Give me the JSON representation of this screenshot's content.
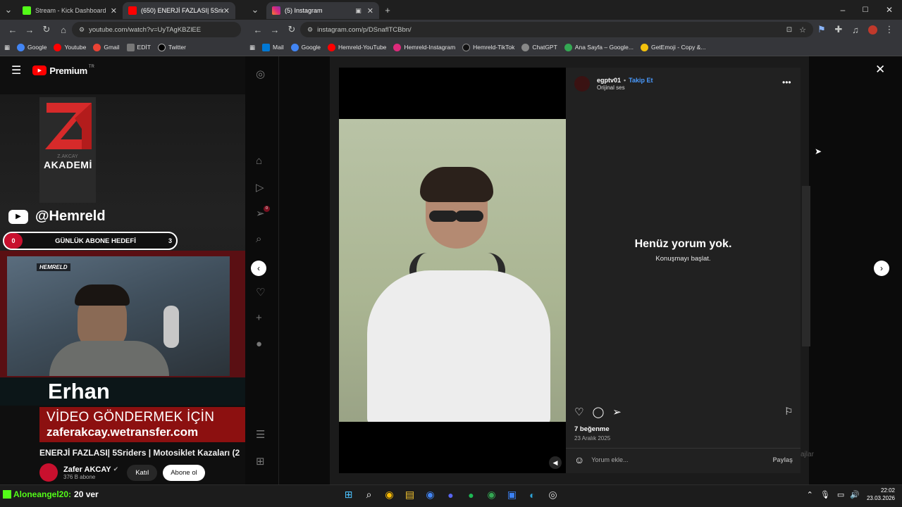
{
  "left": {
    "tabs": [
      {
        "label": "Stream - Kick Dashboard",
        "active": false,
        "color": "#53fc18"
      },
      {
        "label": "(650) ENERJİ FAZLASI| 5Sriders",
        "active": true,
        "color": "#ff0000"
      }
    ],
    "url": "youtube.com/watch?v=UyTAgKBZlEE",
    "bookmarks": [
      "Google",
      "Youtube",
      "Gmail",
      "EDİT",
      "Twitter"
    ],
    "youtube_logo": "Premium",
    "premium_sup": "TR",
    "academy_name": "Z.AKCAY",
    "academy_label": "AKADEMİ",
    "channel_handle": "@Hemreld",
    "sub_goal": {
      "start": "0",
      "label": "GÜNLÜK ABONE HEDEFİ",
      "end": "3"
    },
    "cam_badge": "HEMRELD",
    "streamer_name": "Erhan",
    "send_video_line1": "VİDEO GÖNDERMEK İÇİN",
    "send_video_line2": "zaferakcay.wetransfer.com",
    "video_title": "ENERJİ FAZLASI| 5Sriders | Motosiklet Kazaları (2",
    "channel_name": "Zafer AKCAY",
    "subscriber_count": "376 B abone",
    "join_label": "Katıl",
    "subscribe_label": "Abone ol"
  },
  "right": {
    "tab_label": "(5) Instagram",
    "url": "instagram.com/p/DSnaflTCBbn/",
    "bookmarks": [
      "Mail",
      "Google",
      "Hemreld-YouTube",
      "Hemreld-Instagram",
      "Hemreld-TikTok",
      "ChatGPT",
      "Ana Sayfa – Google...",
      "GetEmoji - Copy &..."
    ],
    "post": {
      "username": "egptv01",
      "follow_label": "Takip Et",
      "audio": "Orijinal ses",
      "empty_title": "Henüz yorum yok.",
      "empty_subtitle": "Konuşmayı başlat.",
      "likes": "7 beğenme",
      "date": "23 Aralık 2025",
      "comment_placeholder": "Yorum ekle...",
      "share_label": "Paylaş"
    },
    "background_hint": "ajlar",
    "notification_badge": "0"
  },
  "chat_line": {
    "user": "Aloneangel20:",
    "text": "20 ver"
  },
  "taskbar": {
    "time": "22:02",
    "date": "23.03.2026"
  }
}
